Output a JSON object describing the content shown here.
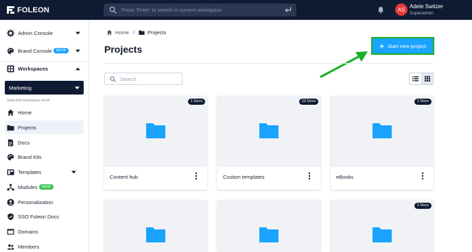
{
  "app": {
    "logo_text": "FOLEON",
    "search_placeholder": "Press 'Enter' to search in current workspace",
    "user": {
      "initials": "AS",
      "name": "Adele Switzer",
      "role": "Superadmin",
      "avatar_color": "#e53935"
    }
  },
  "sidebar": {
    "admin_console": "Admin Console",
    "brand_console": "Brand Console",
    "brand_console_badge": "BETA",
    "workspaces": "Workspaces",
    "workspace_selected": "Marketing",
    "workspace_hint": "Selected workspace-level",
    "items": [
      {
        "label": "Home",
        "icon": "home-icon"
      },
      {
        "label": "Projects",
        "icon": "folder-icon",
        "active": true
      },
      {
        "label": "Docs",
        "icon": "doc-icon"
      },
      {
        "label": "Brand Kits",
        "icon": "palette-icon"
      },
      {
        "label": "Templates",
        "icon": "templates-icon"
      },
      {
        "label": "Modules",
        "icon": "modules-icon",
        "badge": "NEW"
      },
      {
        "label": "Personalization",
        "icon": "person-icon"
      },
      {
        "label": "SSO Foleon Docs",
        "icon": "shield-icon"
      },
      {
        "label": "Domains",
        "icon": "domains-icon"
      },
      {
        "label": "Members",
        "icon": "members-icon"
      }
    ]
  },
  "breadcrumb": {
    "home": "Home",
    "separator": "/",
    "current": "Projects"
  },
  "page": {
    "title": "Projects",
    "start_button": "Start new project",
    "search_placeholder": "Search"
  },
  "projects": [
    {
      "name": "Content hub",
      "count": "1 Docs"
    },
    {
      "name": "Custom templates",
      "count": "10 Docs"
    },
    {
      "name": "eBooks",
      "count": "1 Docs"
    },
    {
      "name": "",
      "count": ""
    },
    {
      "name": "",
      "count": ""
    },
    {
      "name": "",
      "count": "3 Docs"
    }
  ],
  "colors": {
    "topbar": "#0f1a33",
    "accent": "#1aa3ff",
    "highlight": "#17b026",
    "folder": "#1aa3ff",
    "badge_beta": "#1aa3ff",
    "badge_new": "#3ec65a"
  }
}
